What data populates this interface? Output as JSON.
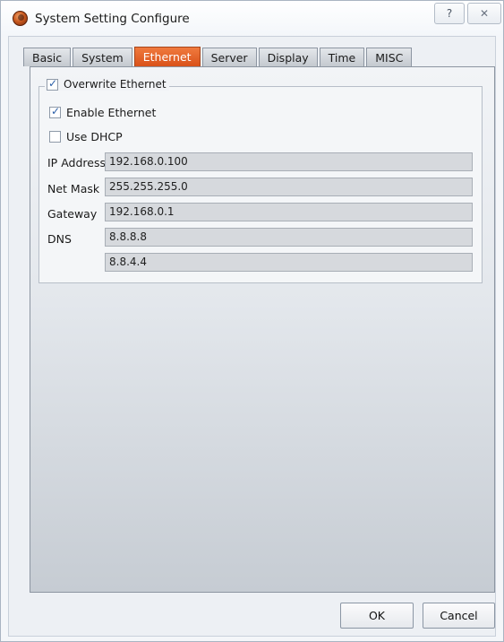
{
  "window": {
    "title": "System Setting Configure",
    "help_label": "?",
    "close_label": "✕"
  },
  "tabs": [
    {
      "label": "Basic",
      "active": false
    },
    {
      "label": "System",
      "active": false
    },
    {
      "label": "Ethernet",
      "active": true
    },
    {
      "label": "Server",
      "active": false
    },
    {
      "label": "Display",
      "active": false
    },
    {
      "label": "Time",
      "active": false
    },
    {
      "label": "MISC",
      "active": false
    }
  ],
  "ethernet": {
    "overwrite_label": "Overwrite Ethernet",
    "overwrite_checked": true,
    "enable_label": "Enable Ethernet",
    "enable_checked": true,
    "dhcp_label": "Use DHCP",
    "dhcp_checked": false,
    "ip_label": "IP Address",
    "ip_value": "192.168.0.100",
    "netmask_label": "Net Mask",
    "netmask_value": "255.255.255.0",
    "gateway_label": "Gateway",
    "gateway_value": "192.168.0.1",
    "dns_label": "DNS",
    "dns1_value": "8.8.8.8",
    "dns2_value": "8.8.4.4"
  },
  "footer": {
    "ok_label": "OK",
    "cancel_label": "Cancel"
  },
  "colors": {
    "active_tab": "#e8642a",
    "field_bg": "#d6d9dd",
    "check": "#2a5ea8"
  }
}
